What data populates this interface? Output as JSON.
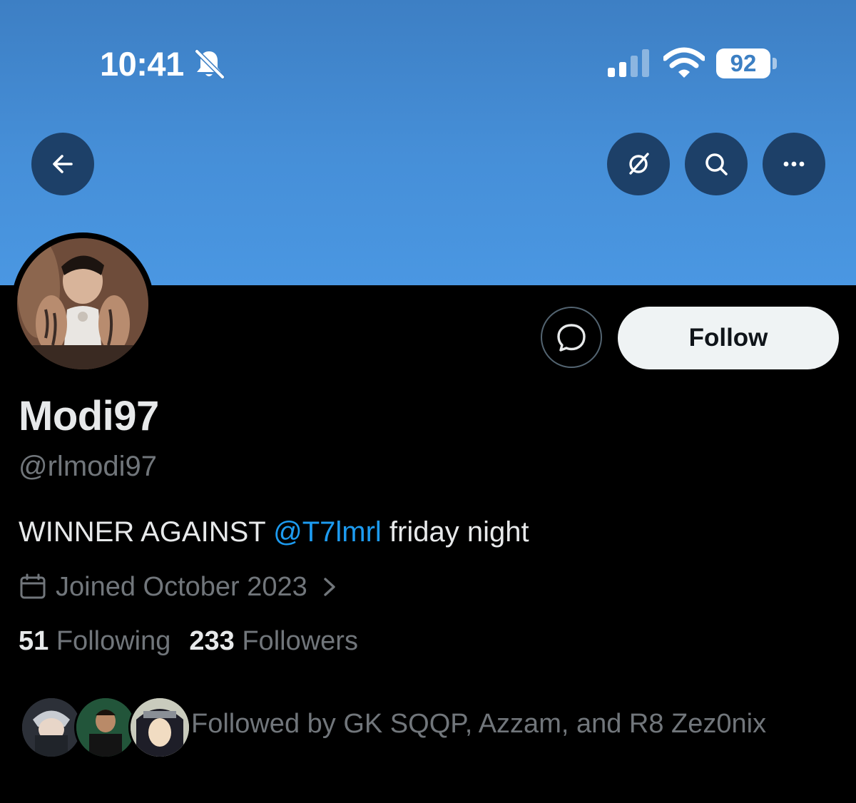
{
  "status_bar": {
    "time": "10:41",
    "battery": "92",
    "icons": [
      "bell-slash-icon",
      "signal-icon",
      "wifi-icon",
      "battery-icon"
    ]
  },
  "header": {
    "buttons": [
      "back-arrow-icon",
      "grok-icon",
      "search-icon",
      "more-icon"
    ]
  },
  "profile": {
    "display_name": "Modi97",
    "handle": "@rlmodi97",
    "bio_prefix": "WINNER AGAINST ",
    "bio_mention": "@T7lmrl",
    "bio_suffix": " friday night",
    "joined": "Joined October 2023",
    "following_count": "51",
    "following_label": "Following",
    "followers_count": "233",
    "followers_label": "Followers",
    "followed_by": "Followed by GK SQQP, Azzam, and R8 Zez0nix"
  },
  "actions": {
    "follow_label": "Follow",
    "message_icon": "message-icon"
  },
  "colors": {
    "banner_top": "#3d7fc4",
    "banner_bottom": "#4a97e2",
    "mention": "#1d9bf0",
    "muted_text": "#71767b",
    "follow_button_bg": "#eff3f4",
    "header_button_bg": "#1d4068"
  }
}
